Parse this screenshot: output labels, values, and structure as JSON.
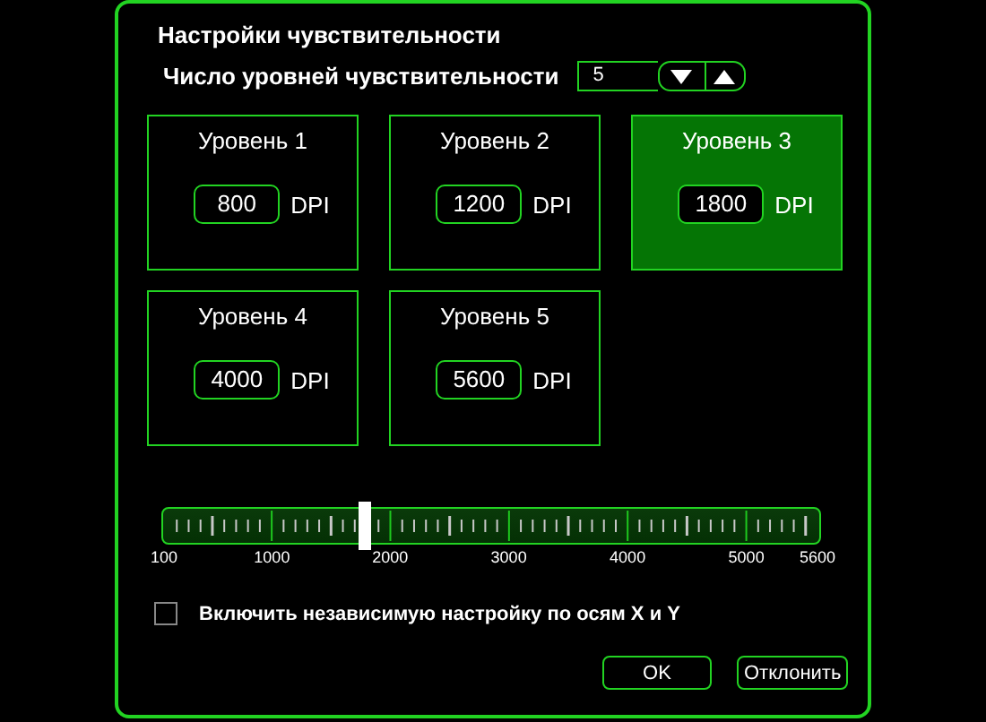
{
  "title": "Настройки чувствительности",
  "level_count": {
    "label": "Число уровней чувствительности",
    "value": "5"
  },
  "levels": [
    {
      "title": "Уровень 1",
      "value": "800",
      "unit": "DPI",
      "selected": false
    },
    {
      "title": "Уровень 2",
      "value": "1200",
      "unit": "DPI",
      "selected": false
    },
    {
      "title": "Уровень 3",
      "value": "1800",
      "unit": "DPI",
      "selected": true
    },
    {
      "title": "Уровень 4",
      "value": "4000",
      "unit": "DPI",
      "selected": false
    },
    {
      "title": "Уровень 5",
      "value": "5600",
      "unit": "DPI",
      "selected": false
    }
  ],
  "slider": {
    "level": 0.309,
    "labels": [
      "100",
      "1000",
      "2000",
      "3000",
      "4000",
      "5000",
      "5600"
    ]
  },
  "independent_axes": {
    "label": "Включить независимую настройку по осям X и Y",
    "checked": false
  },
  "buttons": [
    "OK",
    "Отклонить"
  ]
}
